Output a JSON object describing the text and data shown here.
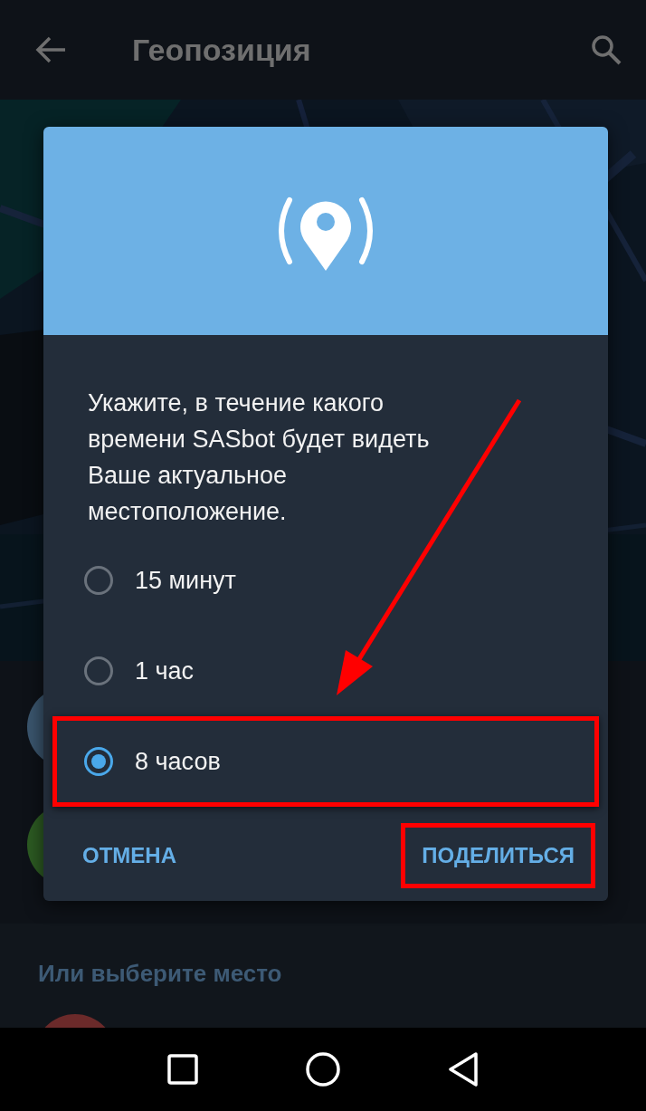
{
  "toolbar": {
    "title": "Геопозиция"
  },
  "section_header": "Или выберите место",
  "dialog": {
    "message": "Укажите, в течение какого времени SASbot будет видеть Ваше актуальное местоположение.",
    "options": [
      {
        "label": "15 минут",
        "selected": false,
        "highlighted": false
      },
      {
        "label": "1 час",
        "selected": false,
        "highlighted": false
      },
      {
        "label": "8 часов",
        "selected": true,
        "highlighted": true
      }
    ],
    "buttons": [
      {
        "label": "ОТМЕНА",
        "highlighted": false
      },
      {
        "label": "ПОДЕЛИТЬСЯ",
        "highlighted": true
      }
    ]
  }
}
